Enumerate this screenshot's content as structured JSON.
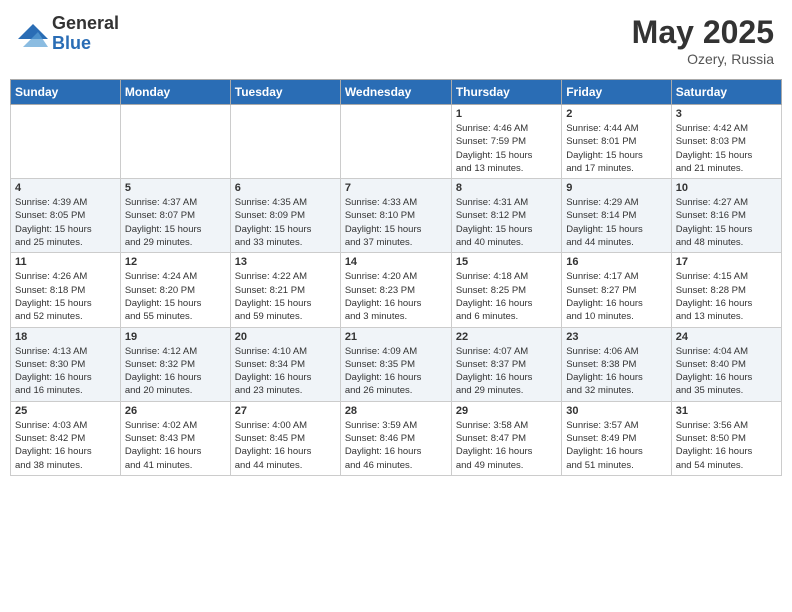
{
  "header": {
    "logo_general": "General",
    "logo_blue": "Blue",
    "month_year": "May 2025",
    "location": "Ozery, Russia"
  },
  "days_of_week": [
    "Sunday",
    "Monday",
    "Tuesday",
    "Wednesday",
    "Thursday",
    "Friday",
    "Saturday"
  ],
  "weeks": [
    [
      {
        "day": "",
        "info": ""
      },
      {
        "day": "",
        "info": ""
      },
      {
        "day": "",
        "info": ""
      },
      {
        "day": "",
        "info": ""
      },
      {
        "day": "1",
        "info": "Sunrise: 4:46 AM\nSunset: 7:59 PM\nDaylight: 15 hours\nand 13 minutes."
      },
      {
        "day": "2",
        "info": "Sunrise: 4:44 AM\nSunset: 8:01 PM\nDaylight: 15 hours\nand 17 minutes."
      },
      {
        "day": "3",
        "info": "Sunrise: 4:42 AM\nSunset: 8:03 PM\nDaylight: 15 hours\nand 21 minutes."
      }
    ],
    [
      {
        "day": "4",
        "info": "Sunrise: 4:39 AM\nSunset: 8:05 PM\nDaylight: 15 hours\nand 25 minutes."
      },
      {
        "day": "5",
        "info": "Sunrise: 4:37 AM\nSunset: 8:07 PM\nDaylight: 15 hours\nand 29 minutes."
      },
      {
        "day": "6",
        "info": "Sunrise: 4:35 AM\nSunset: 8:09 PM\nDaylight: 15 hours\nand 33 minutes."
      },
      {
        "day": "7",
        "info": "Sunrise: 4:33 AM\nSunset: 8:10 PM\nDaylight: 15 hours\nand 37 minutes."
      },
      {
        "day": "8",
        "info": "Sunrise: 4:31 AM\nSunset: 8:12 PM\nDaylight: 15 hours\nand 40 minutes."
      },
      {
        "day": "9",
        "info": "Sunrise: 4:29 AM\nSunset: 8:14 PM\nDaylight: 15 hours\nand 44 minutes."
      },
      {
        "day": "10",
        "info": "Sunrise: 4:27 AM\nSunset: 8:16 PM\nDaylight: 15 hours\nand 48 minutes."
      }
    ],
    [
      {
        "day": "11",
        "info": "Sunrise: 4:26 AM\nSunset: 8:18 PM\nDaylight: 15 hours\nand 52 minutes."
      },
      {
        "day": "12",
        "info": "Sunrise: 4:24 AM\nSunset: 8:20 PM\nDaylight: 15 hours\nand 55 minutes."
      },
      {
        "day": "13",
        "info": "Sunrise: 4:22 AM\nSunset: 8:21 PM\nDaylight: 15 hours\nand 59 minutes."
      },
      {
        "day": "14",
        "info": "Sunrise: 4:20 AM\nSunset: 8:23 PM\nDaylight: 16 hours\nand 3 minutes."
      },
      {
        "day": "15",
        "info": "Sunrise: 4:18 AM\nSunset: 8:25 PM\nDaylight: 16 hours\nand 6 minutes."
      },
      {
        "day": "16",
        "info": "Sunrise: 4:17 AM\nSunset: 8:27 PM\nDaylight: 16 hours\nand 10 minutes."
      },
      {
        "day": "17",
        "info": "Sunrise: 4:15 AM\nSunset: 8:28 PM\nDaylight: 16 hours\nand 13 minutes."
      }
    ],
    [
      {
        "day": "18",
        "info": "Sunrise: 4:13 AM\nSunset: 8:30 PM\nDaylight: 16 hours\nand 16 minutes."
      },
      {
        "day": "19",
        "info": "Sunrise: 4:12 AM\nSunset: 8:32 PM\nDaylight: 16 hours\nand 20 minutes."
      },
      {
        "day": "20",
        "info": "Sunrise: 4:10 AM\nSunset: 8:34 PM\nDaylight: 16 hours\nand 23 minutes."
      },
      {
        "day": "21",
        "info": "Sunrise: 4:09 AM\nSunset: 8:35 PM\nDaylight: 16 hours\nand 26 minutes."
      },
      {
        "day": "22",
        "info": "Sunrise: 4:07 AM\nSunset: 8:37 PM\nDaylight: 16 hours\nand 29 minutes."
      },
      {
        "day": "23",
        "info": "Sunrise: 4:06 AM\nSunset: 8:38 PM\nDaylight: 16 hours\nand 32 minutes."
      },
      {
        "day": "24",
        "info": "Sunrise: 4:04 AM\nSunset: 8:40 PM\nDaylight: 16 hours\nand 35 minutes."
      }
    ],
    [
      {
        "day": "25",
        "info": "Sunrise: 4:03 AM\nSunset: 8:42 PM\nDaylight: 16 hours\nand 38 minutes."
      },
      {
        "day": "26",
        "info": "Sunrise: 4:02 AM\nSunset: 8:43 PM\nDaylight: 16 hours\nand 41 minutes."
      },
      {
        "day": "27",
        "info": "Sunrise: 4:00 AM\nSunset: 8:45 PM\nDaylight: 16 hours\nand 44 minutes."
      },
      {
        "day": "28",
        "info": "Sunrise: 3:59 AM\nSunset: 8:46 PM\nDaylight: 16 hours\nand 46 minutes."
      },
      {
        "day": "29",
        "info": "Sunrise: 3:58 AM\nSunset: 8:47 PM\nDaylight: 16 hours\nand 49 minutes."
      },
      {
        "day": "30",
        "info": "Sunrise: 3:57 AM\nSunset: 8:49 PM\nDaylight: 16 hours\nand 51 minutes."
      },
      {
        "day": "31",
        "info": "Sunrise: 3:56 AM\nSunset: 8:50 PM\nDaylight: 16 hours\nand 54 minutes."
      }
    ]
  ]
}
